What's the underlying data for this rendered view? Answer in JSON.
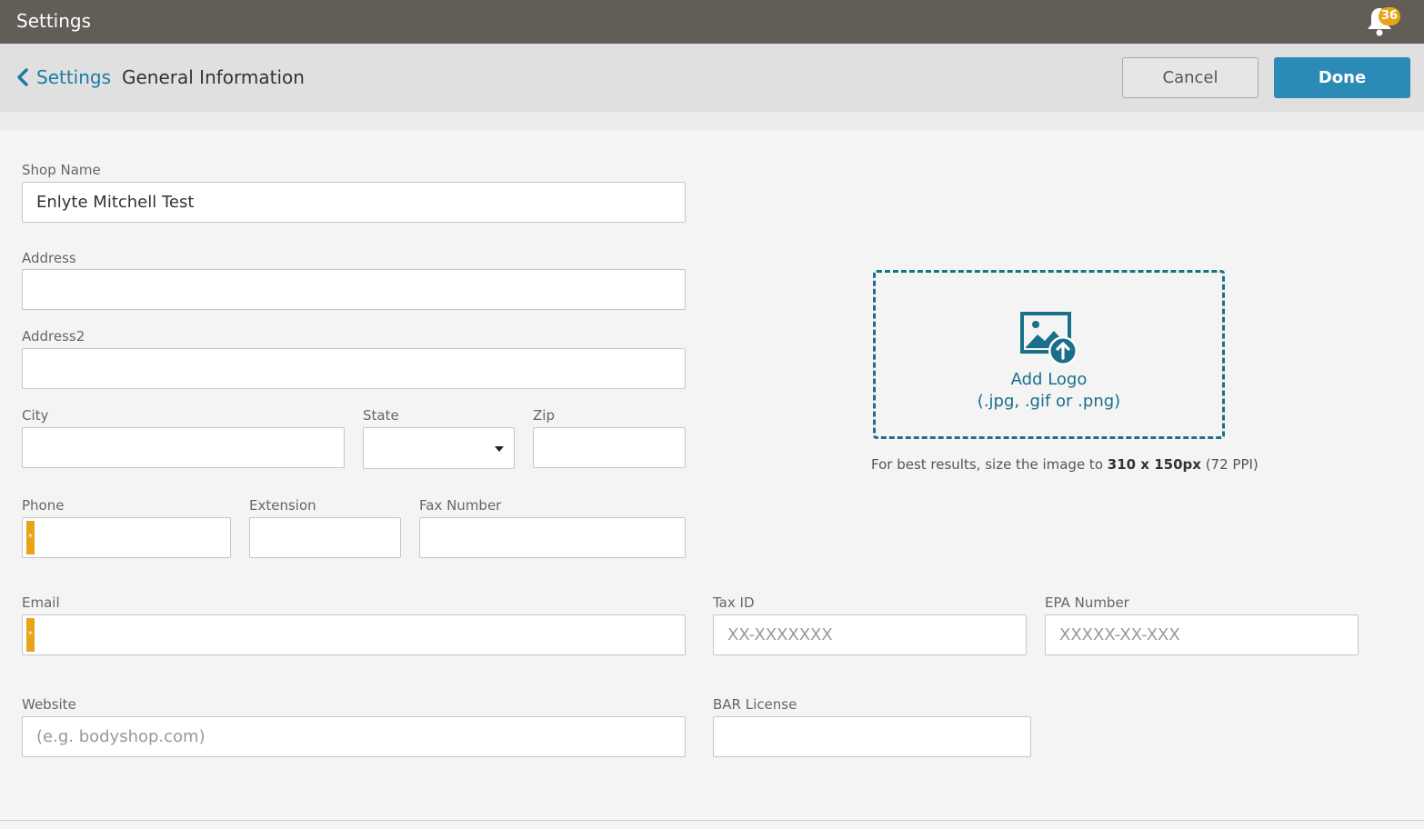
{
  "titlebar": {
    "title": "Settings",
    "notification_count": "36"
  },
  "header": {
    "back_label": "Settings",
    "page_title": "General Information",
    "cancel_label": "Cancel",
    "done_label": "Done"
  },
  "form": {
    "shop_name": {
      "label": "Shop Name",
      "value": "Enlyte Mitchell Test"
    },
    "address": {
      "label": "Address",
      "value": ""
    },
    "address2": {
      "label": "Address2",
      "value": ""
    },
    "city": {
      "label": "City",
      "value": ""
    },
    "state": {
      "label": "State",
      "value": ""
    },
    "zip": {
      "label": "Zip",
      "value": ""
    },
    "phone": {
      "label": "Phone",
      "value": "",
      "required_marker": "*"
    },
    "extension": {
      "label": "Extension",
      "value": ""
    },
    "fax": {
      "label": "Fax Number",
      "value": ""
    },
    "email": {
      "label": "Email",
      "value": "",
      "required_marker": "*"
    },
    "tax_id": {
      "label": "Tax ID",
      "placeholder": "XX-XXXXXXX"
    },
    "epa": {
      "label": "EPA Number",
      "placeholder": "XXXXX-XX-XXX"
    },
    "website": {
      "label": "Website",
      "placeholder": "(e.g. bodyshop.com)"
    },
    "bar_license": {
      "label": "BAR License",
      "value": ""
    }
  },
  "logo": {
    "icon": "image-upload-icon",
    "title": "Add Logo",
    "formats": "(.jpg, .gif or .png)",
    "hint_prefix": "For best results, size the image to ",
    "hint_size": "310 x 150px",
    "hint_suffix": " (72 PPI)"
  },
  "colors": {
    "titlebar": "#625d57",
    "accent": "#2b8bb6",
    "link": "#1a7ca3",
    "required": "#e8a317",
    "logo_border": "#1a6f8a"
  }
}
